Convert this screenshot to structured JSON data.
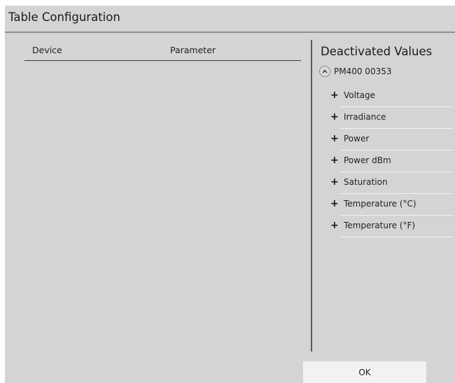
{
  "dialog": {
    "title": "Table Configuration"
  },
  "table": {
    "columns": [
      "Device",
      "Parameter"
    ],
    "rows": []
  },
  "deactivated": {
    "title": "Deactivated Values",
    "device": {
      "label": "PM400 00353",
      "expanded": true,
      "toggle_icon": "chevron-up-icon"
    },
    "item_icon": "plus-icon",
    "items": [
      {
        "label": "Voltage"
      },
      {
        "label": "Irradiance"
      },
      {
        "label": "Power"
      },
      {
        "label": "Power dBm"
      },
      {
        "label": "Saturation"
      },
      {
        "label": "Temperature (°C)"
      },
      {
        "label": "Temperature (°F)"
      }
    ]
  },
  "footer": {
    "ok_label": "OK"
  },
  "colors": {
    "dialog_bg": "#d4d4d4",
    "button_bg": "#f2f2f2",
    "separator": "#5a5a5a"
  }
}
